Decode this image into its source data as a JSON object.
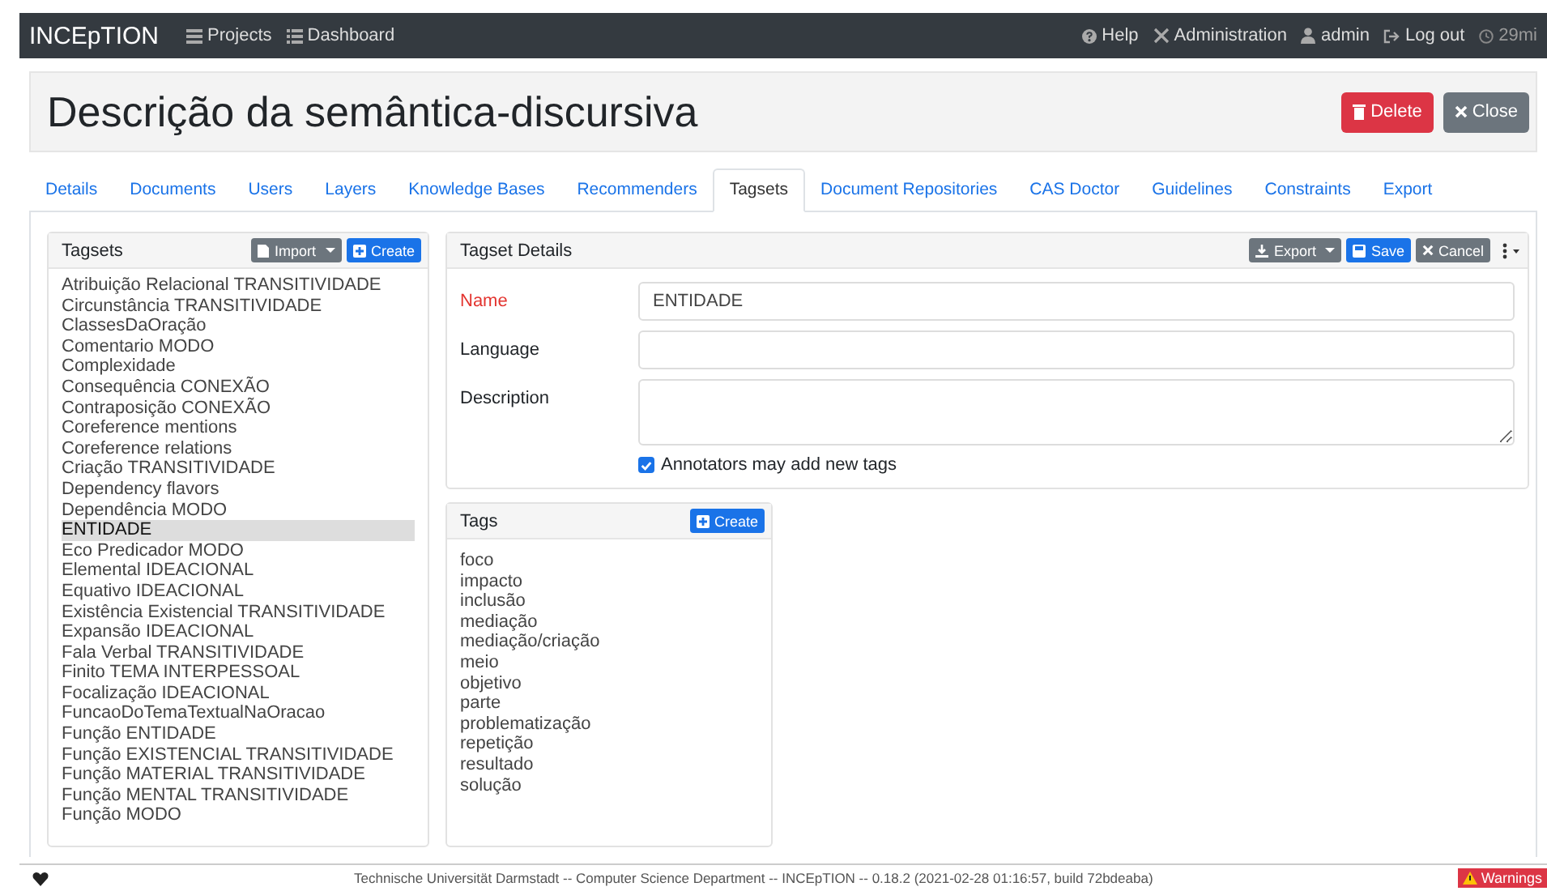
{
  "navbar": {
    "brand": "INCEpTION",
    "links": [
      {
        "label": "Projects"
      },
      {
        "label": "Dashboard"
      }
    ],
    "right": [
      {
        "label": "Help"
      },
      {
        "label": "Administration"
      },
      {
        "label": "admin"
      },
      {
        "label": "Log out"
      },
      {
        "label": "29mi"
      }
    ]
  },
  "page": {
    "title": "Descrição da semântica-discursiva",
    "buttons": [
      {
        "kind": "danger",
        "label": "Delete"
      },
      {
        "kind": "secondary",
        "label": "Close"
      }
    ]
  },
  "tabs": [
    {
      "label": "Details",
      "selected": false
    },
    {
      "label": "Documents",
      "selected": false
    },
    {
      "label": "Users",
      "selected": false
    },
    {
      "label": "Layers",
      "selected": false
    },
    {
      "label": "Knowledge Bases",
      "selected": false
    },
    {
      "label": "Recommenders",
      "selected": false
    },
    {
      "label": "Tagsets",
      "selected": true
    },
    {
      "label": "Document Repositories",
      "selected": false
    },
    {
      "label": "CAS Doctor",
      "selected": false
    },
    {
      "label": "Guidelines",
      "selected": false
    },
    {
      "label": "Constraints",
      "selected": false
    },
    {
      "label": "Export",
      "selected": false
    }
  ],
  "tagsets": {
    "title": "Tagsets",
    "buttons": [
      {
        "kind": "secondary",
        "label": "Import",
        "dropdown": true
      },
      {
        "kind": "primary",
        "label": "Create",
        "dropdown": false
      }
    ],
    "items": [
      {
        "label": "Atribuição Relacional TRANSITIVIDADE",
        "selected": false
      },
      {
        "label": "Circunstância TRANSITIVIDADE",
        "selected": false
      },
      {
        "label": "ClassesDaOração",
        "selected": false
      },
      {
        "label": "Comentario MODO",
        "selected": false
      },
      {
        "label": "Complexidade",
        "selected": false
      },
      {
        "label": "Consequência CONEXÃO",
        "selected": false
      },
      {
        "label": "Contraposição CONEXÃO",
        "selected": false
      },
      {
        "label": "Coreference mentions",
        "selected": false
      },
      {
        "label": "Coreference relations",
        "selected": false
      },
      {
        "label": "Criação TRANSITIVIDADE",
        "selected": false
      },
      {
        "label": "Dependency flavors",
        "selected": false
      },
      {
        "label": "Dependência MODO",
        "selected": false
      },
      {
        "label": "ENTIDADE",
        "selected": true
      },
      {
        "label": "Eco Predicador MODO",
        "selected": false
      },
      {
        "label": "Elemental IDEACIONAL",
        "selected": false
      },
      {
        "label": "Equativo IDEACIONAL",
        "selected": false
      },
      {
        "label": "Existência Existencial TRANSITIVIDADE",
        "selected": false
      },
      {
        "label": "Expansão IDEACIONAL",
        "selected": false
      },
      {
        "label": "Fala Verbal TRANSITIVIDADE",
        "selected": false
      },
      {
        "label": "Finito TEMA INTERPESSOAL",
        "selected": false
      },
      {
        "label": "Focalização IDEACIONAL",
        "selected": false
      },
      {
        "label": "FuncaoDoTemaTextualNaOracao",
        "selected": false
      },
      {
        "label": "Função ENTIDADE",
        "selected": false
      },
      {
        "label": "Função EXISTENCIAL TRANSITIVIDADE",
        "selected": false
      },
      {
        "label": "Função MATERIAL TRANSITIVIDADE",
        "selected": false
      },
      {
        "label": "Função MENTAL TRANSITIVIDADE",
        "selected": false
      },
      {
        "label": "Função MODO",
        "selected": false
      }
    ]
  },
  "details": {
    "title": "Tagset Details",
    "buttons": [
      {
        "kind": "secondary",
        "label": "Export",
        "dropdown": true
      },
      {
        "kind": "primary",
        "label": "Save",
        "dropdown": false
      },
      {
        "kind": "secondary",
        "label": "Cancel",
        "dropdown": false
      }
    ],
    "fields": [
      {
        "kind": "input",
        "label": "Name",
        "required": true,
        "value": "ENTIDADE"
      },
      {
        "kind": "input",
        "label": "Language",
        "required": false
      },
      {
        "kind": "textarea",
        "label": "Description",
        "required": false
      }
    ],
    "checkbox": {
      "label": "Annotators may add new tags",
      "checked": true
    }
  },
  "tags": {
    "title": "Tags",
    "button": {
      "label": "Create"
    },
    "items": [
      "foco",
      "impacto",
      "inclusão",
      "mediação",
      "mediação/criação",
      "meio",
      "objetivo",
      "parte",
      "problematização",
      "repetição",
      "resultado",
      "solução"
    ]
  },
  "footer": {
    "text": "Technische Universität Darmstadt -- Computer Science Department -- INCEpTION -- 0.18.2 (2021-02-28 01:16:57, build 72bdeaba)",
    "badge": "Warnings"
  }
}
